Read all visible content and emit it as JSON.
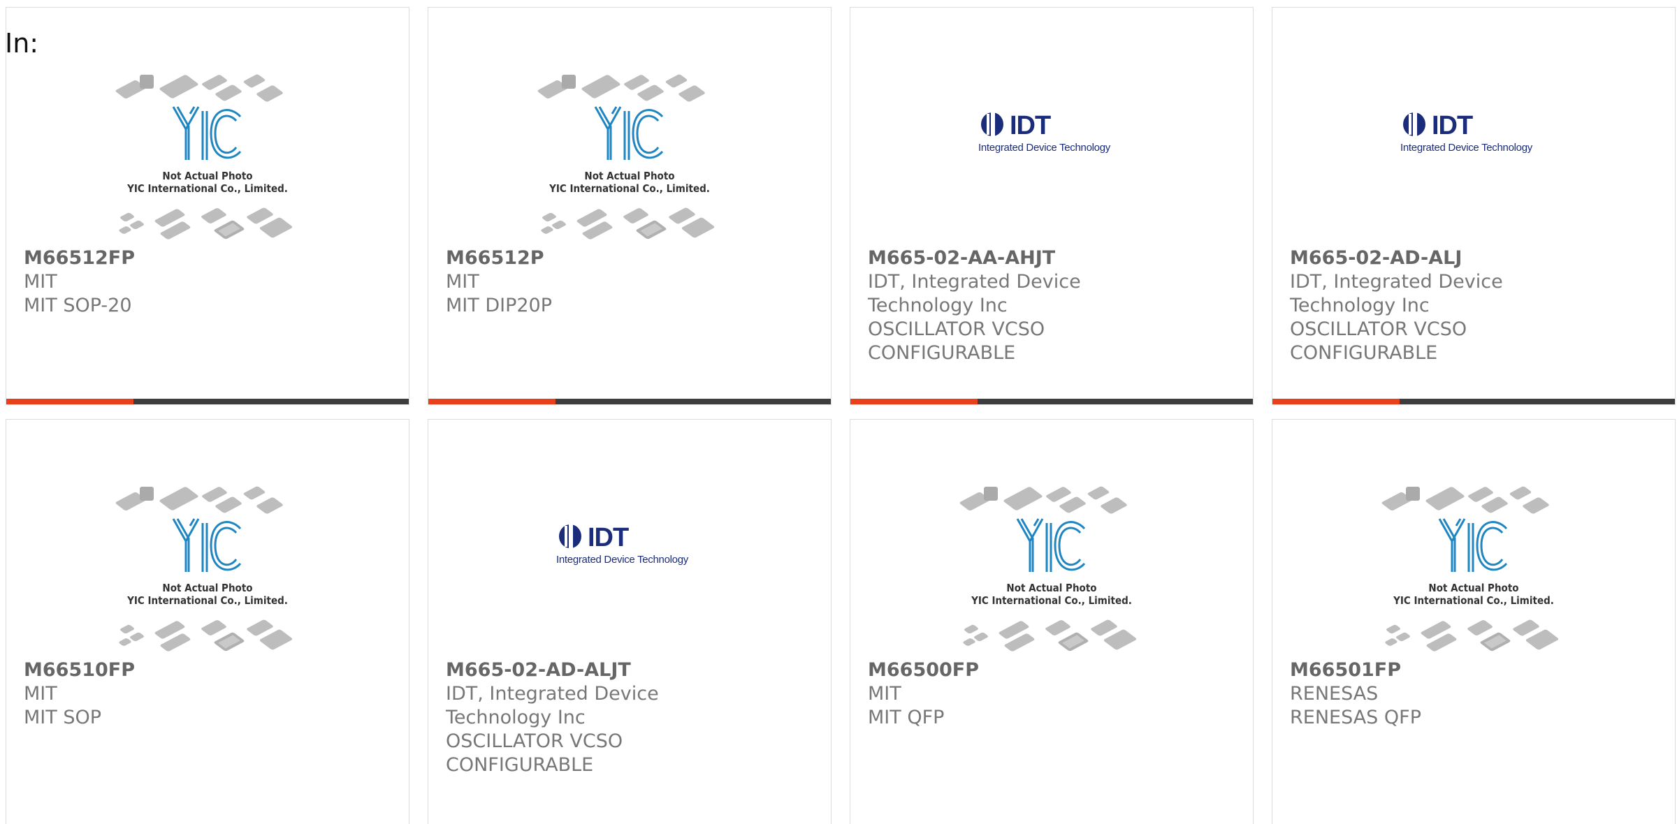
{
  "filter_label": "In:",
  "colors": {
    "accent": "#e8401c",
    "bar": "#3d3d3d",
    "idt_blue": "#1b2c7a",
    "yic_blue": "#1f86c2"
  },
  "products": [
    {
      "part": "M66512FP",
      "manufacturer": "MIT",
      "desc1": "MIT SOP-20",
      "desc2": "",
      "image": "yic",
      "img_cap1": "Not Actual Photo",
      "img_cap2": "YIC International Co., Limited."
    },
    {
      "part": "M66512P",
      "manufacturer": "MIT",
      "desc1": "MIT DIP20P",
      "desc2": "",
      "image": "yic",
      "img_cap1": "Not Actual Photo",
      "img_cap2": "YIC International Co., Limited."
    },
    {
      "part": "M665-02-AA-AHJT",
      "manufacturer": "IDT, Integrated Device",
      "desc1": "Technology Inc",
      "desc2": "OSCILLATOR VCSO",
      "desc3": "CONFIGURABLE",
      "image": "idt",
      "logo_name": "IDT",
      "logo_sub": "Integrated Device Technology"
    },
    {
      "part": "M665-02-AD-ALJ",
      "manufacturer": "IDT, Integrated Device",
      "desc1": "Technology Inc",
      "desc2": "OSCILLATOR VCSO",
      "desc3": "CONFIGURABLE",
      "image": "idt",
      "logo_name": "IDT",
      "logo_sub": "Integrated Device Technology"
    },
    {
      "part": "M66510FP",
      "manufacturer": "MIT",
      "desc1": "MIT SOP",
      "desc2": "",
      "image": "yic",
      "img_cap1": "Not Actual Photo",
      "img_cap2": "YIC International Co., Limited."
    },
    {
      "part": "M665-02-AD-ALJT",
      "manufacturer": "IDT, Integrated Device",
      "desc1": "Technology Inc",
      "desc2": "OSCILLATOR VCSO",
      "desc3": "CONFIGURABLE",
      "image": "idt",
      "logo_name": "IDT",
      "logo_sub": "Integrated Device Technology"
    },
    {
      "part": "M66500FP",
      "manufacturer": "MIT",
      "desc1": "MIT QFP",
      "desc2": "",
      "image": "yic",
      "img_cap1": "Not Actual Photo",
      "img_cap2": "YIC International Co., Limited."
    },
    {
      "part": "M66501FP",
      "manufacturer": "RENESAS",
      "desc1": "RENESAS QFP",
      "desc2": "",
      "image": "yic",
      "img_cap1": "Not Actual Photo",
      "img_cap2": "YIC International Co., Limited."
    }
  ]
}
